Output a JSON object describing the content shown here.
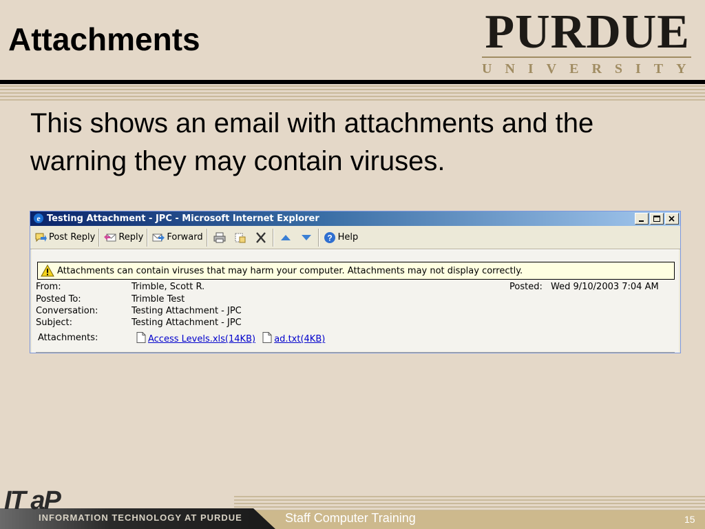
{
  "slide": {
    "title": "Attachments",
    "body": "This shows an email with attachments and the warning they may contain viruses."
  },
  "logo": {
    "wordmark": "PURDUE",
    "subtitle": "UNIVERSITY"
  },
  "ie_window": {
    "title": "Testing Attachment - JPC - Microsoft Internet Explorer",
    "toolbar": {
      "post_reply": "Post Reply",
      "reply": "Reply",
      "forward": "Forward",
      "help": "Help"
    },
    "warning": "Attachments can contain viruses that may harm your computer. Attachments may not display correctly.",
    "headers": {
      "from_label": "From:",
      "from_value": "Trimble, Scott R.",
      "posted_to_label": "Posted To:",
      "posted_to_value": "Trimble Test",
      "conversation_label": "Conversation:",
      "conversation_value": "Testing Attachment - JPC",
      "subject_label": "Subject:",
      "subject_value": "Testing Attachment - JPC",
      "attachments_label": "Attachments:",
      "posted_label": "Posted:",
      "posted_value": "Wed 9/10/2003 7:04 AM"
    },
    "attachments": [
      {
        "name": "Access Levels.xls(14KB)"
      },
      {
        "name": "ad.txt(4KB)"
      }
    ]
  },
  "footer": {
    "logo_text": "IT aP",
    "tagline": "INFORMATION TECHNOLOGY AT PURDUE",
    "center": "Staff Computer Training",
    "page_number": "15"
  },
  "colors": {
    "background": "#e4d8c8",
    "titlebar_start": "#0a246a",
    "warning_bg": "#ffffe1",
    "link": "#0000cc"
  }
}
